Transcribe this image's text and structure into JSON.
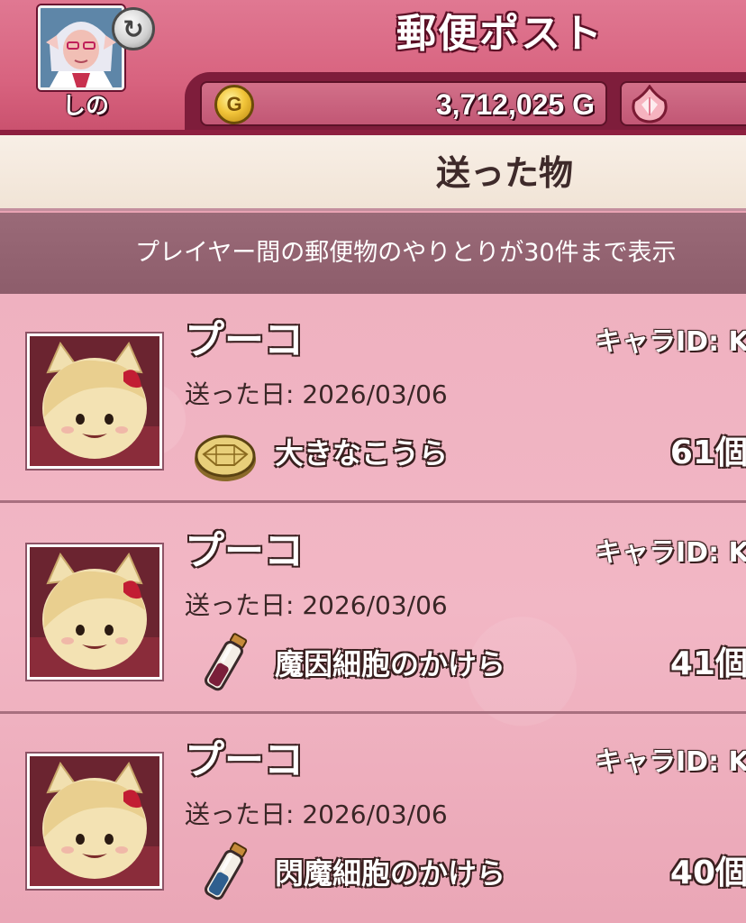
{
  "header": {
    "title": "郵便ポスト",
    "player_name": "しの",
    "gold": "3,712,025 G",
    "gold_icon_glyph": "G",
    "swap_glyph": "↻"
  },
  "subheader": {
    "title": "送った物"
  },
  "info": {
    "text": "プレイヤー間の郵便物のやりとりが30件まで表示"
  },
  "colors": {
    "header_pink": "#d8637f",
    "header_dark": "#7e1d3b",
    "list_pink": "#f2b7c5",
    "info_strip": "#9a6a78",
    "subheader_cream": "#f8efe6"
  },
  "mails": [
    {
      "sender": "プーコ",
      "chara_id_label": "キャラID: K",
      "sent_date": "送った日: 2026/03/06",
      "item_name": "大きなこうら",
      "item_icon": "shell-icon",
      "count": "61個"
    },
    {
      "sender": "プーコ",
      "chara_id_label": "キャラID: K",
      "sent_date": "送った日: 2026/03/06",
      "item_name": "魔因細胞のかけら",
      "item_icon": "red-vial-icon",
      "count": "41個"
    },
    {
      "sender": "プーコ",
      "chara_id_label": "キャラID: K",
      "sent_date": "送った日: 2026/03/06",
      "item_name": "閃魔細胞のかけら",
      "item_icon": "blue-vial-icon",
      "count": "40個"
    }
  ]
}
